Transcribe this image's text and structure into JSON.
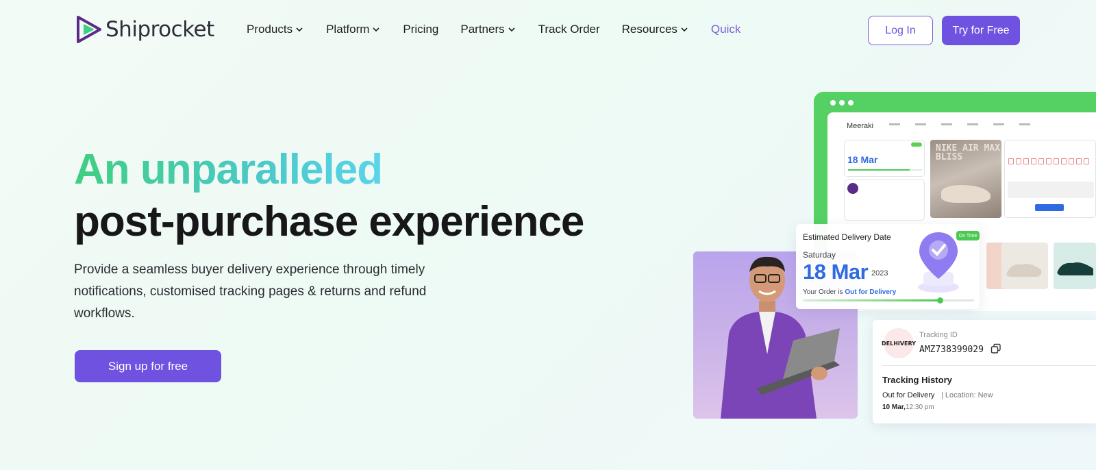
{
  "brand": {
    "name": "Shiprocket",
    "accent": "#6f52e0"
  },
  "nav": {
    "items": [
      {
        "label": "Products",
        "dropdown": true
      },
      {
        "label": "Platform",
        "dropdown": true
      },
      {
        "label": "Pricing",
        "dropdown": false
      },
      {
        "label": "Partners",
        "dropdown": true
      },
      {
        "label": "Track Order",
        "dropdown": false
      },
      {
        "label": "Resources",
        "dropdown": true
      },
      {
        "label": "Quick",
        "dropdown": false
      }
    ],
    "login_label": "Log In",
    "try_label": "Try for Free"
  },
  "hero": {
    "headline_line1": "An unparalleled",
    "headline_line2": "post-purchase experience",
    "subtext": "Provide a seamless buyer delivery experience through timely notifications, customised tracking pages & returns and refund workflows.",
    "cta_label": "Sign up for free"
  },
  "mockup": {
    "store_name": "Meeraki",
    "mini_date": "18 Mar",
    "shoe_print": "NIKE AIR MAX BLISS"
  },
  "delivery_card": {
    "title": "Estimated Delivery Date",
    "badge": "On Time",
    "day": "Saturday",
    "date": "18 Mar",
    "year": "2023",
    "order_prefix": "Your Order is ",
    "order_status": "Out for Delivery",
    "progress": 0.8
  },
  "tracking_card": {
    "courier": "DELHIVERY",
    "id_label": "Tracking ID",
    "id_value": "AMZ738399029",
    "history_title": "Tracking History",
    "status": "Out for Delivery",
    "location": "| Location: New",
    "date": "10 Mar,",
    "time": "12:30 pm"
  }
}
